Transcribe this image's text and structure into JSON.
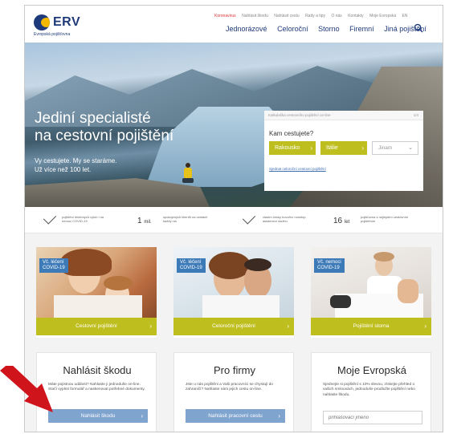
{
  "brand": {
    "name": "ERV",
    "tagline": "Evropská pojišťovna"
  },
  "top_links": [
    "Koronavirus",
    "Nahlásit škodu",
    "Nahlásit cestu",
    "Rady a tipy",
    "O nás",
    "Kontakty",
    "Moje Evropská",
    "EN"
  ],
  "main_nav": [
    "Jednorázové",
    "Celoroční",
    "Storno",
    "Firemní",
    "Jiná pojištění"
  ],
  "hero": {
    "title_line1": "Jediní specialisté",
    "title_line2": "na cestovní pojištění",
    "sub_line1": "Vy cestujete. My se staráme.",
    "sub_line2": "Už více než 100 let."
  },
  "booking": {
    "header": "Kalkulačka cestovního pojištění on-line",
    "step": "1/4",
    "question": "Kam cestujete?",
    "buttons": [
      "Rakousko",
      "Itálie"
    ],
    "select_value": "Jinam",
    "link": "Sjednat celoroční cestovní pojištění"
  },
  "stats": [
    {
      "text": "pojištění léčebných výloh i na nemoc COVID-19"
    },
    {
      "value": "1",
      "unit": "mil.",
      "text": "spokojených klientů na cestách každý rok"
    },
    {
      "text": "vlastní česky hovořící nonstop asistenční službu"
    },
    {
      "value": "16",
      "unit": "let",
      "text": "pojišťovna s nejlepším cestovním pojištěním"
    }
  ],
  "cards": [
    {
      "tag_line1": "Vč. léčení",
      "tag_line2": "COVID-19",
      "label": "Cestovní pojištění"
    },
    {
      "tag_line1": "Vč. léčení",
      "tag_line2": "COVID-19",
      "label": "Celoroční pojištění"
    },
    {
      "tag_line1": "Vč. nemoci",
      "tag_line2": "COVID-19",
      "label": "Pojištění storna"
    }
  ],
  "panels": [
    {
      "title": "Nahlásit škodu",
      "text": "Máte pojistnou událost? Nahlaste ji jednoduše on-line. Stačí vyplnit formulář a naskenovat potřebné dokumenty.",
      "button": "Nahlásit škodu"
    },
    {
      "title": "Pro firmy",
      "text": "Jste u nás pojištěni a Vaši pracovníci se chystají do zahraničí? Nahlaste nám jejich cestu on-line.",
      "button": "Nahlásit pracovní cestu"
    },
    {
      "title": "Moje Evropská",
      "text": "Sjednejte si pojištění s 10% slevou, získejte přehled o vašich smlouvách, jednoduše prodlužte pojištění nebo nahlaste škodu.",
      "input_placeholder": "přihlašovací jméno"
    }
  ],
  "colors": {
    "brand_navy": "#1e3a7a",
    "accent_olive": "#bfbe1f",
    "button_blue": "#7fa4ce",
    "tag_blue": "#3d7ab8",
    "annotation_red": "#d0141b"
  }
}
